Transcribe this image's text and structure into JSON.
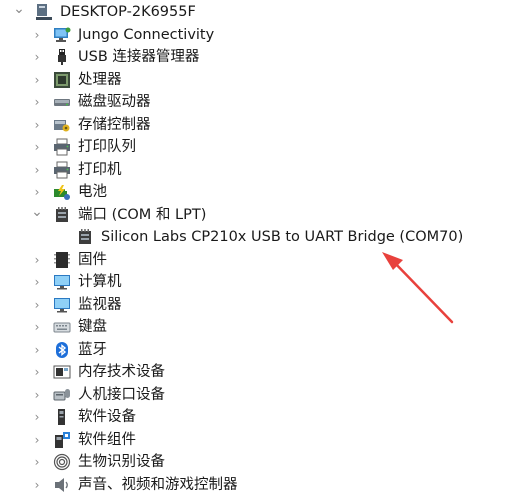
{
  "root": {
    "label": "DESKTOP-2K6955F",
    "icon": "computer-icon",
    "expanded": true
  },
  "categories": [
    {
      "label": "Jungo Connectivity",
      "icon": "network-monitor-icon",
      "expanded": false
    },
    {
      "label": "USB 连接器管理器",
      "icon": "usb-plug-icon",
      "expanded": false
    },
    {
      "label": "处理器",
      "icon": "processor-chip-icon",
      "expanded": false
    },
    {
      "label": "磁盘驱动器",
      "icon": "disk-drive-icon",
      "expanded": false
    },
    {
      "label": "存储控制器",
      "icon": "storage-controller-icon",
      "expanded": false
    },
    {
      "label": "打印队列",
      "icon": "printer-icon",
      "expanded": false
    },
    {
      "label": "打印机",
      "icon": "printer-icon",
      "expanded": false
    },
    {
      "label": "电池",
      "icon": "battery-icon",
      "expanded": false
    },
    {
      "label": "端口 (COM 和 LPT)",
      "icon": "port-connector-icon",
      "expanded": true,
      "children": [
        {
          "label": "Silicon Labs CP210x USB to UART Bridge (COM70)",
          "icon": "port-connector-icon"
        }
      ]
    },
    {
      "label": "固件",
      "icon": "firmware-chip-icon",
      "expanded": false
    },
    {
      "label": "计算机",
      "icon": "monitor-icon",
      "expanded": false
    },
    {
      "label": "监视器",
      "icon": "monitor-icon",
      "expanded": false
    },
    {
      "label": "键盘",
      "icon": "keyboard-icon",
      "expanded": false
    },
    {
      "label": "蓝牙",
      "icon": "bluetooth-icon",
      "expanded": false
    },
    {
      "label": "内存技术设备",
      "icon": "memory-device-icon",
      "expanded": false
    },
    {
      "label": "人机接口设备",
      "icon": "hid-device-icon",
      "expanded": false
    },
    {
      "label": "软件设备",
      "icon": "software-device-icon",
      "expanded": false
    },
    {
      "label": "软件组件",
      "icon": "software-component-icon",
      "expanded": false
    },
    {
      "label": "生物识别设备",
      "icon": "fingerprint-icon",
      "expanded": false
    },
    {
      "label": "声音、视频和游戏控制器",
      "icon": "speaker-icon",
      "expanded": false
    }
  ],
  "annotation": {
    "color": "#e8413c",
    "icon": "red-arrow-annotation"
  }
}
